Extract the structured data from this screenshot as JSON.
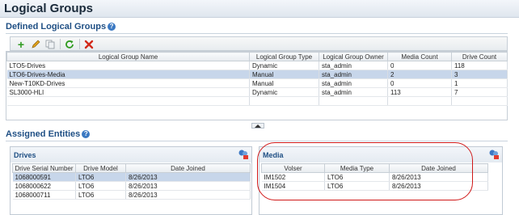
{
  "page": {
    "title": "Logical Groups"
  },
  "defined_section": {
    "title": "Defined Logical Groups",
    "toolbar": {
      "icons": [
        "add-icon",
        "edit-icon",
        "copy-icon",
        "refresh-icon",
        "delete-icon"
      ]
    },
    "table": {
      "columns": [
        "Logical Group Name",
        "Logical Group Type",
        "Logical Group Owner",
        "Media Count",
        "Drive Count"
      ],
      "rows": [
        {
          "name": "LTO5-Drives",
          "type": "Dynamic",
          "owner": "sta_admin",
          "media": "0",
          "drives": "118",
          "selected": false
        },
        {
          "name": "LTO6-Drives-Media",
          "type": "Manual",
          "owner": "sta_admin",
          "media": "2",
          "drives": "3",
          "selected": true
        },
        {
          "name": "New-T10KD-Drives",
          "type": "Manual",
          "owner": "sta_admin",
          "media": "0",
          "drives": "1",
          "selected": false
        },
        {
          "name": "SL3000-HLI",
          "type": "Dynamic",
          "owner": "sta_admin",
          "media": "113",
          "drives": "7",
          "selected": false
        }
      ]
    }
  },
  "assigned_section": {
    "title": "Assigned Entities"
  },
  "drives_panel": {
    "title": "Drives",
    "columns": [
      "Drive Serial Number",
      "Drive Model",
      "Date Joined"
    ],
    "rows": [
      {
        "serial": "1068000591",
        "model": "LTO6",
        "date": "8/26/2013",
        "selected": true
      },
      {
        "serial": "1068000622",
        "model": "LTO6",
        "date": "8/26/2013",
        "selected": false
      },
      {
        "serial": "1068000711",
        "model": "LTO6",
        "date": "8/26/2013",
        "selected": false
      }
    ]
  },
  "media_panel": {
    "title": "Media",
    "columns": [
      "Volser",
      "Media Type",
      "Date Joined"
    ],
    "rows": [
      {
        "volser": "IM1502",
        "type": "LTO6",
        "date": "8/26/2013"
      },
      {
        "volser": "IM1504",
        "type": "LTO6",
        "date": "8/26/2013"
      }
    ]
  },
  "colors": {
    "accent_title": "#1f4f84",
    "selection": "#c7d6ea",
    "annotation_ring": "#d01818"
  }
}
